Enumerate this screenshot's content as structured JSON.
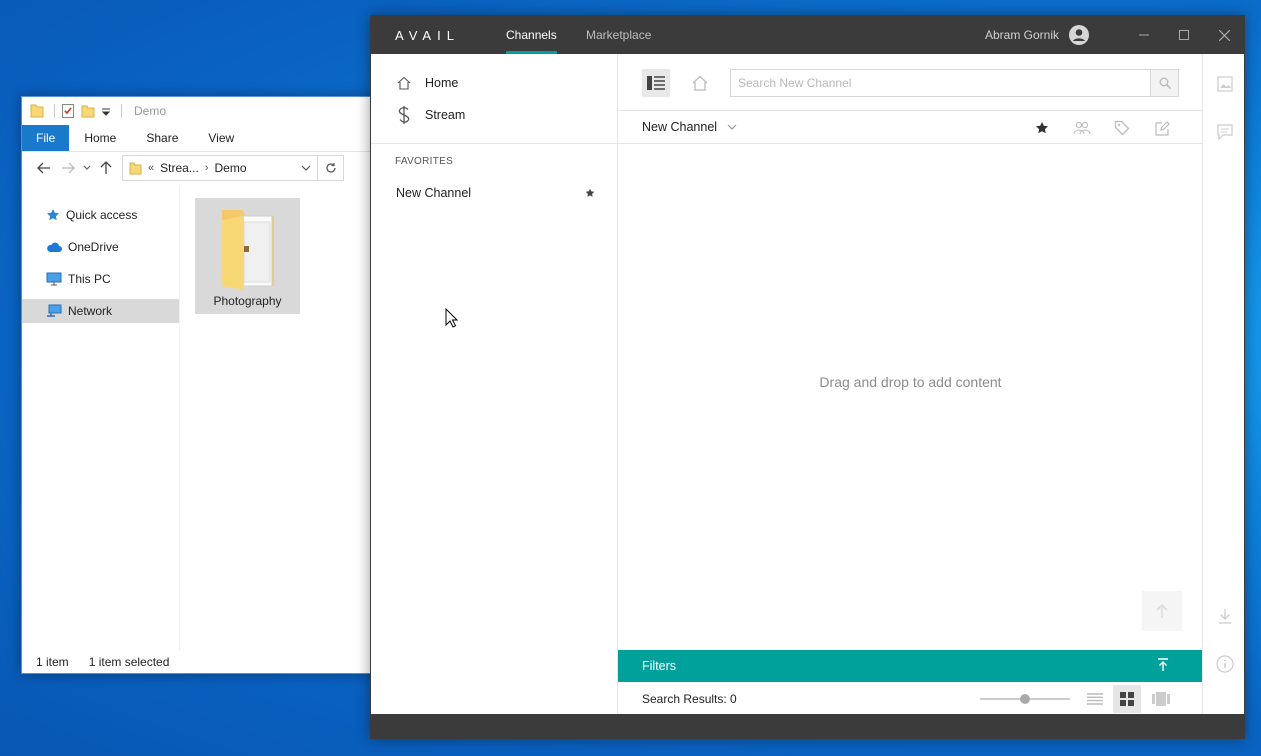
{
  "explorer": {
    "title": "Demo",
    "ribbon_tabs": [
      "File",
      "Home",
      "Share",
      "View"
    ],
    "address": {
      "prefix": "«",
      "crumbs": [
        "Strea...",
        "Demo"
      ]
    },
    "sidebar": [
      {
        "label": "Quick access",
        "icon": "star-icon"
      },
      {
        "label": "OneDrive",
        "icon": "cloud-icon"
      },
      {
        "label": "This PC",
        "icon": "monitor-icon"
      },
      {
        "label": "Network",
        "icon": "network-icon"
      }
    ],
    "folder": {
      "name": "Photography"
    },
    "status": {
      "count": "1 item",
      "selected": "1 item selected"
    }
  },
  "avail": {
    "logo": "AVAIL",
    "tabs": [
      "Channels",
      "Marketplace"
    ],
    "user": "Abram Gornik",
    "nav": [
      {
        "label": "Home",
        "icon": "home-icon"
      },
      {
        "label": "Stream",
        "icon": "stream-icon"
      }
    ],
    "favorites_heading": "FAVORITES",
    "favorites": [
      {
        "label": "New Channel"
      }
    ],
    "search_placeholder": "Search New Channel",
    "channel_name": "New Channel",
    "empty_message": "Drag and drop to add content",
    "filters_label": "Filters",
    "results_label": "Search Results: 0",
    "accent_color": "#00a19a"
  }
}
